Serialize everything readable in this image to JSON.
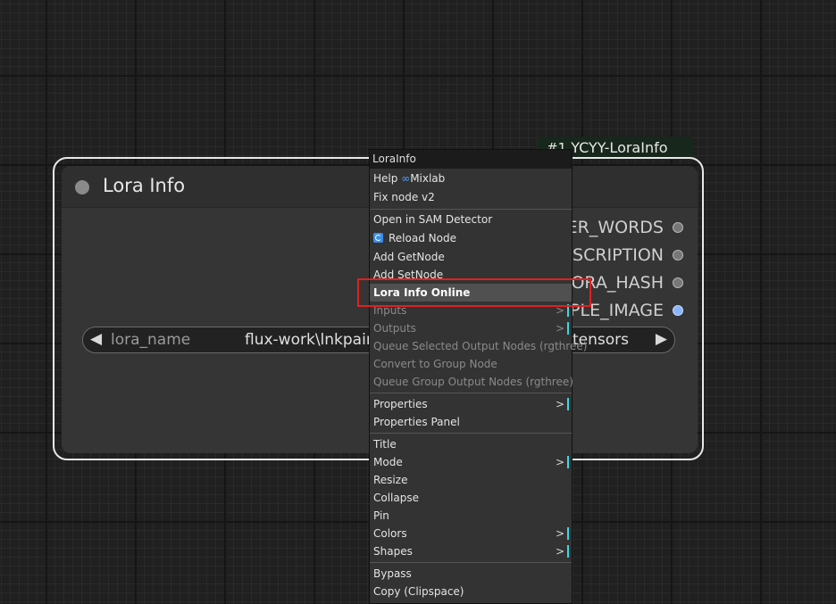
{
  "badge": {
    "number": "#1",
    "title": "YCYY-LoraInfo"
  },
  "node": {
    "title": "Lora Info",
    "outputs": [
      "SER_WORDS",
      "ESCRIPTION",
      "LORA_HASH",
      "IPLE_IMAGE"
    ],
    "widget": {
      "label": "lora_name",
      "value": "flux-work\\lnkpain",
      "value_end": "tensors"
    }
  },
  "menu": {
    "title": "LoraInfo",
    "help_label": "Help",
    "mixlab_label": "Mixlab",
    "fix_node": "Fix node v2",
    "open_sam": "Open in SAM Detector",
    "reload_node": "Reload Node",
    "add_getnode": "Add GetNode",
    "add_setnode": "Add SetNode",
    "lora_info_online": "Lora Info Online",
    "inputs": "Inputs",
    "outputs": "Outputs",
    "queue_selected": "Queue Selected Output Nodes (rgthree)",
    "convert_group": "Convert to Group Node",
    "queue_group": "Queue Group Output Nodes (rgthree)",
    "properties": "Properties",
    "properties_panel": "Properties Panel",
    "title_item": "Title",
    "mode": "Mode",
    "resize": "Resize",
    "collapse": "Collapse",
    "pin": "Pin",
    "colors": "Colors",
    "shapes": "Shapes",
    "bypass": "Bypass",
    "copy_clipspace": "Copy (Clipspace)",
    "submenu_arrow": ">"
  }
}
